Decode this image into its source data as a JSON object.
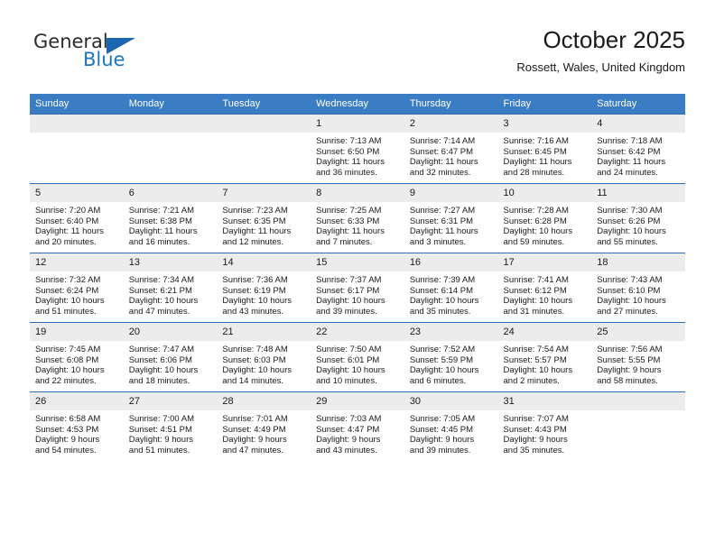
{
  "brand": {
    "name_part1": "General",
    "name_part2": "Blue",
    "triangle_icon": "triangle-icon",
    "accent_color": "#1b75bb"
  },
  "header": {
    "title": "October 2025",
    "location": "Rossett, Wales, United Kingdom"
  },
  "theme": {
    "header_row_bg": "#3b7dc4",
    "row_divider": "#2e6daf",
    "daynum_bg": "#ececec",
    "text": "#1a1a1a"
  },
  "weekday_headers": [
    "Sunday",
    "Monday",
    "Tuesday",
    "Wednesday",
    "Thursday",
    "Friday",
    "Saturday"
  ],
  "weeks": [
    [
      {
        "day": "",
        "sunrise": "",
        "sunset": "",
        "daylight1": "",
        "daylight2": ""
      },
      {
        "day": "",
        "sunrise": "",
        "sunset": "",
        "daylight1": "",
        "daylight2": ""
      },
      {
        "day": "",
        "sunrise": "",
        "sunset": "",
        "daylight1": "",
        "daylight2": ""
      },
      {
        "day": "1",
        "sunrise": "Sunrise: 7:13 AM",
        "sunset": "Sunset: 6:50 PM",
        "daylight1": "Daylight: 11 hours",
        "daylight2": "and 36 minutes."
      },
      {
        "day": "2",
        "sunrise": "Sunrise: 7:14 AM",
        "sunset": "Sunset: 6:47 PM",
        "daylight1": "Daylight: 11 hours",
        "daylight2": "and 32 minutes."
      },
      {
        "day": "3",
        "sunrise": "Sunrise: 7:16 AM",
        "sunset": "Sunset: 6:45 PM",
        "daylight1": "Daylight: 11 hours",
        "daylight2": "and 28 minutes."
      },
      {
        "day": "4",
        "sunrise": "Sunrise: 7:18 AM",
        "sunset": "Sunset: 6:42 PM",
        "daylight1": "Daylight: 11 hours",
        "daylight2": "and 24 minutes."
      }
    ],
    [
      {
        "day": "5",
        "sunrise": "Sunrise: 7:20 AM",
        "sunset": "Sunset: 6:40 PM",
        "daylight1": "Daylight: 11 hours",
        "daylight2": "and 20 minutes."
      },
      {
        "day": "6",
        "sunrise": "Sunrise: 7:21 AM",
        "sunset": "Sunset: 6:38 PM",
        "daylight1": "Daylight: 11 hours",
        "daylight2": "and 16 minutes."
      },
      {
        "day": "7",
        "sunrise": "Sunrise: 7:23 AM",
        "sunset": "Sunset: 6:35 PM",
        "daylight1": "Daylight: 11 hours",
        "daylight2": "and 12 minutes."
      },
      {
        "day": "8",
        "sunrise": "Sunrise: 7:25 AM",
        "sunset": "Sunset: 6:33 PM",
        "daylight1": "Daylight: 11 hours",
        "daylight2": "and 7 minutes."
      },
      {
        "day": "9",
        "sunrise": "Sunrise: 7:27 AM",
        "sunset": "Sunset: 6:31 PM",
        "daylight1": "Daylight: 11 hours",
        "daylight2": "and 3 minutes."
      },
      {
        "day": "10",
        "sunrise": "Sunrise: 7:28 AM",
        "sunset": "Sunset: 6:28 PM",
        "daylight1": "Daylight: 10 hours",
        "daylight2": "and 59 minutes."
      },
      {
        "day": "11",
        "sunrise": "Sunrise: 7:30 AM",
        "sunset": "Sunset: 6:26 PM",
        "daylight1": "Daylight: 10 hours",
        "daylight2": "and 55 minutes."
      }
    ],
    [
      {
        "day": "12",
        "sunrise": "Sunrise: 7:32 AM",
        "sunset": "Sunset: 6:24 PM",
        "daylight1": "Daylight: 10 hours",
        "daylight2": "and 51 minutes."
      },
      {
        "day": "13",
        "sunrise": "Sunrise: 7:34 AM",
        "sunset": "Sunset: 6:21 PM",
        "daylight1": "Daylight: 10 hours",
        "daylight2": "and 47 minutes."
      },
      {
        "day": "14",
        "sunrise": "Sunrise: 7:36 AM",
        "sunset": "Sunset: 6:19 PM",
        "daylight1": "Daylight: 10 hours",
        "daylight2": "and 43 minutes."
      },
      {
        "day": "15",
        "sunrise": "Sunrise: 7:37 AM",
        "sunset": "Sunset: 6:17 PM",
        "daylight1": "Daylight: 10 hours",
        "daylight2": "and 39 minutes."
      },
      {
        "day": "16",
        "sunrise": "Sunrise: 7:39 AM",
        "sunset": "Sunset: 6:14 PM",
        "daylight1": "Daylight: 10 hours",
        "daylight2": "and 35 minutes."
      },
      {
        "day": "17",
        "sunrise": "Sunrise: 7:41 AM",
        "sunset": "Sunset: 6:12 PM",
        "daylight1": "Daylight: 10 hours",
        "daylight2": "and 31 minutes."
      },
      {
        "day": "18",
        "sunrise": "Sunrise: 7:43 AM",
        "sunset": "Sunset: 6:10 PM",
        "daylight1": "Daylight: 10 hours",
        "daylight2": "and 27 minutes."
      }
    ],
    [
      {
        "day": "19",
        "sunrise": "Sunrise: 7:45 AM",
        "sunset": "Sunset: 6:08 PM",
        "daylight1": "Daylight: 10 hours",
        "daylight2": "and 22 minutes."
      },
      {
        "day": "20",
        "sunrise": "Sunrise: 7:47 AM",
        "sunset": "Sunset: 6:06 PM",
        "daylight1": "Daylight: 10 hours",
        "daylight2": "and 18 minutes."
      },
      {
        "day": "21",
        "sunrise": "Sunrise: 7:48 AM",
        "sunset": "Sunset: 6:03 PM",
        "daylight1": "Daylight: 10 hours",
        "daylight2": "and 14 minutes."
      },
      {
        "day": "22",
        "sunrise": "Sunrise: 7:50 AM",
        "sunset": "Sunset: 6:01 PM",
        "daylight1": "Daylight: 10 hours",
        "daylight2": "and 10 minutes."
      },
      {
        "day": "23",
        "sunrise": "Sunrise: 7:52 AM",
        "sunset": "Sunset: 5:59 PM",
        "daylight1": "Daylight: 10 hours",
        "daylight2": "and 6 minutes."
      },
      {
        "day": "24",
        "sunrise": "Sunrise: 7:54 AM",
        "sunset": "Sunset: 5:57 PM",
        "daylight1": "Daylight: 10 hours",
        "daylight2": "and 2 minutes."
      },
      {
        "day": "25",
        "sunrise": "Sunrise: 7:56 AM",
        "sunset": "Sunset: 5:55 PM",
        "daylight1": "Daylight: 9 hours",
        "daylight2": "and 58 minutes."
      }
    ],
    [
      {
        "day": "26",
        "sunrise": "Sunrise: 6:58 AM",
        "sunset": "Sunset: 4:53 PM",
        "daylight1": "Daylight: 9 hours",
        "daylight2": "and 54 minutes."
      },
      {
        "day": "27",
        "sunrise": "Sunrise: 7:00 AM",
        "sunset": "Sunset: 4:51 PM",
        "daylight1": "Daylight: 9 hours",
        "daylight2": "and 51 minutes."
      },
      {
        "day": "28",
        "sunrise": "Sunrise: 7:01 AM",
        "sunset": "Sunset: 4:49 PM",
        "daylight1": "Daylight: 9 hours",
        "daylight2": "and 47 minutes."
      },
      {
        "day": "29",
        "sunrise": "Sunrise: 7:03 AM",
        "sunset": "Sunset: 4:47 PM",
        "daylight1": "Daylight: 9 hours",
        "daylight2": "and 43 minutes."
      },
      {
        "day": "30",
        "sunrise": "Sunrise: 7:05 AM",
        "sunset": "Sunset: 4:45 PM",
        "daylight1": "Daylight: 9 hours",
        "daylight2": "and 39 minutes."
      },
      {
        "day": "31",
        "sunrise": "Sunrise: 7:07 AM",
        "sunset": "Sunset: 4:43 PM",
        "daylight1": "Daylight: 9 hours",
        "daylight2": "and 35 minutes."
      },
      {
        "day": "",
        "sunrise": "",
        "sunset": "",
        "daylight1": "",
        "daylight2": ""
      }
    ]
  ]
}
